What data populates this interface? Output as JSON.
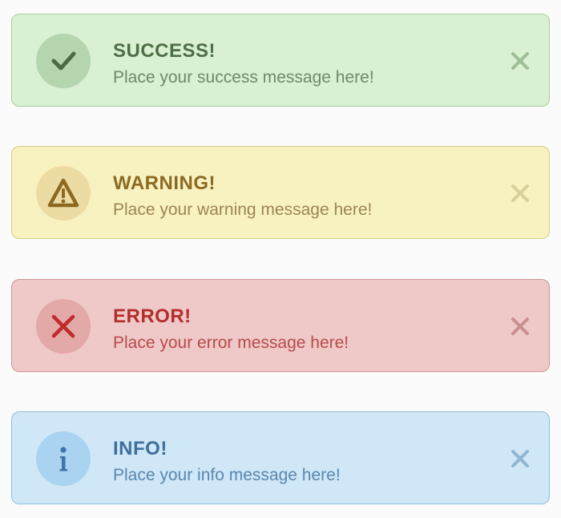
{
  "alerts": {
    "success": {
      "title": "SUCCESS!",
      "message": "Place your success message here!",
      "icon": "check-icon",
      "close_icon": "close-icon",
      "colors": {
        "background": "#d9f0d3",
        "border": "#a9cf9c",
        "accent": "#4e6e47"
      }
    },
    "warning": {
      "title": "WARNING!",
      "message": "Place your warning message here!",
      "icon": "warning-triangle-icon",
      "close_icon": "close-icon",
      "colors": {
        "background": "#f8f2c1",
        "border": "#d6cd87",
        "accent": "#8c6a22"
      }
    },
    "error": {
      "title": "ERROR!",
      "message": "Place your error message here!",
      "icon": "x-icon",
      "close_icon": "close-icon",
      "colors": {
        "background": "#efc8c8",
        "border": "#cf9696",
        "accent": "#b52d2d"
      }
    },
    "info": {
      "title": "INFO!",
      "message": "Place your info message here!",
      "icon": "info-icon",
      "close_icon": "close-icon",
      "colors": {
        "background": "#cfe7f6",
        "border": "#8fbfe0",
        "accent": "#3e6f9c"
      }
    }
  }
}
